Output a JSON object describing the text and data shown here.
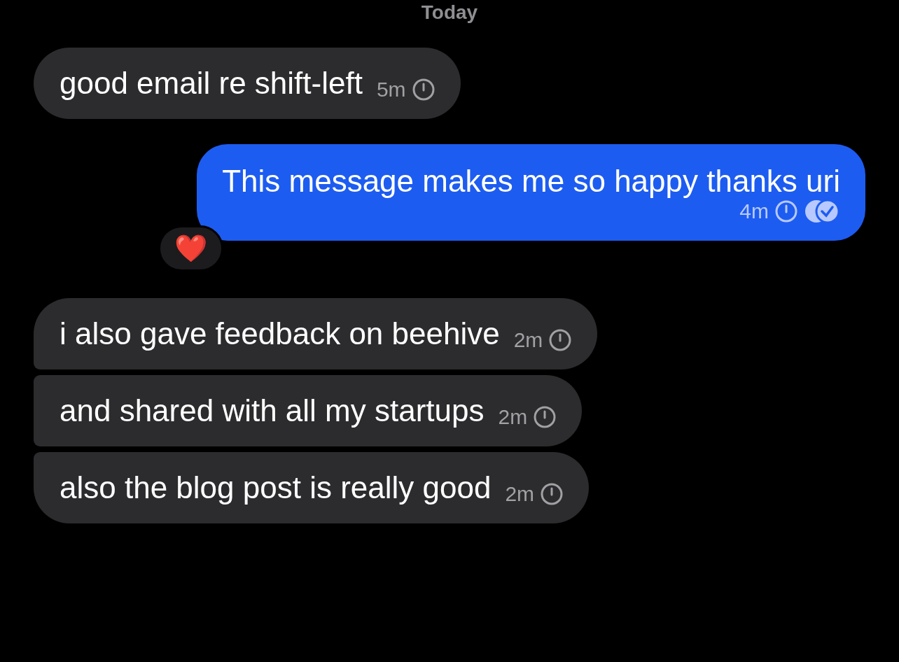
{
  "date_header": "Today",
  "messages": [
    {
      "kind": "incoming",
      "text": "good email re shift-left",
      "time": "5m",
      "read": false
    },
    {
      "kind": "outgoing",
      "text": "This message makes me so happy thanks uri",
      "time": "4m",
      "read": true,
      "reaction": "❤️"
    },
    {
      "kind": "incoming",
      "text": "i also gave feedback on beehive",
      "time": "2m",
      "read": false
    },
    {
      "kind": "incoming",
      "text": "and shared with all my startups",
      "time": "2m",
      "read": false
    },
    {
      "kind": "incoming",
      "text": "also the blog post is really good",
      "time": "2m",
      "read": false
    }
  ]
}
